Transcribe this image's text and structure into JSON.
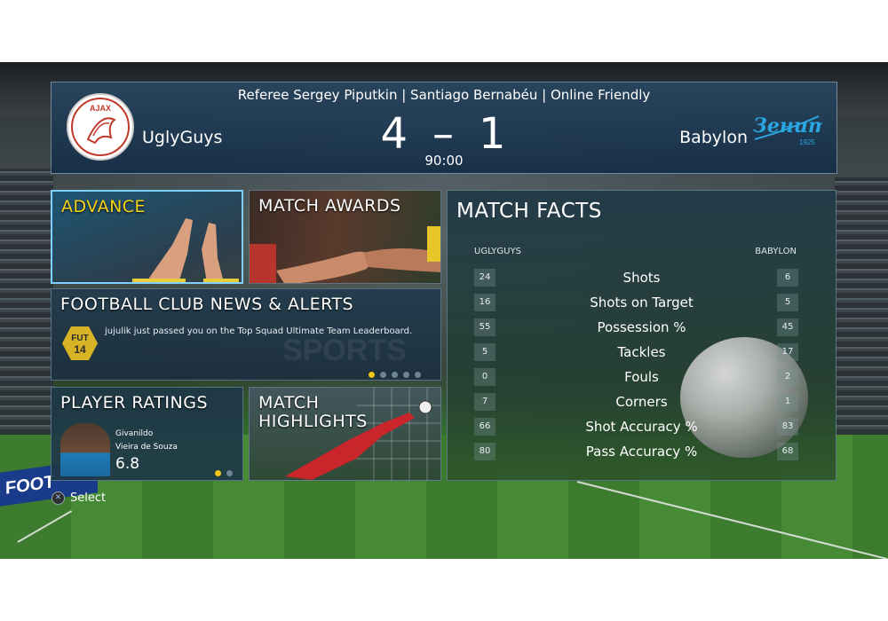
{
  "header": {
    "match_info": "Referee Sergey Piputkin | Santiago Bernabéu | Online Friendly",
    "home_team": "UglyGuys",
    "away_team": "Babylon",
    "home_score": "4",
    "away_score": "1",
    "score_separator": "–",
    "clock": "90:00",
    "home_logo_text": "AJAX",
    "away_logo_text": "Зенит",
    "away_logo_year": "1925"
  },
  "tiles": {
    "advance": "ADVANCE",
    "match_awards": "MATCH AWARDS",
    "news": {
      "title": "FOOTBALL CLUB NEWS & ALERTS",
      "badge_line1": "FUT",
      "badge_line2": "14",
      "message": "jujulik just passed you on the Top Squad Ultimate Team Leaderboard.",
      "watermark": "SPORTS",
      "page_count": 5,
      "active_page": 0
    },
    "player_ratings": {
      "title": "PLAYER RATINGS",
      "first_name": "Givanildo",
      "last_name": "Vieira de Souza",
      "rating": "6.8",
      "page_count": 2,
      "active_page": 0
    },
    "match_highlights": "MATCH HIGHLIGHTS"
  },
  "match_facts": {
    "title": "MATCH FACTS",
    "home_header": "UGLYGUYS",
    "away_header": "BABYLON",
    "rows": [
      {
        "label": "Shots",
        "home": "24",
        "away": "6"
      },
      {
        "label": "Shots on Target",
        "home": "16",
        "away": "5"
      },
      {
        "label": "Possession %",
        "home": "55",
        "away": "45"
      },
      {
        "label": "Tackles",
        "home": "5",
        "away": "17"
      },
      {
        "label": "Fouls",
        "home": "0",
        "away": "2"
      },
      {
        "label": "Corners",
        "home": "7",
        "away": "1"
      },
      {
        "label": "Shot Accuracy %",
        "home": "66",
        "away": "83"
      },
      {
        "label": "Pass Accuracy %",
        "home": "80",
        "away": "68"
      }
    ]
  },
  "footer": {
    "button_glyph": "✕",
    "select_label": "Select"
  },
  "stadium": {
    "board_text": "FOOT"
  },
  "colors": {
    "accent_yellow": "#f6d21a",
    "panel_blue": "#1e3a4f",
    "highlight_border": "#7fd0ff"
  }
}
